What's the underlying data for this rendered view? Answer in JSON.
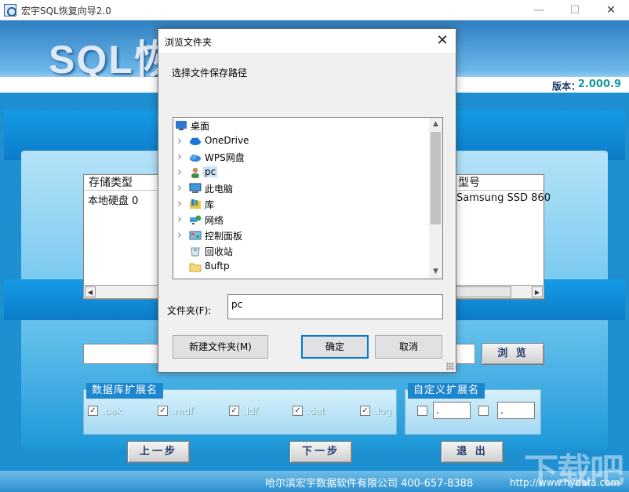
{
  "app": {
    "title": "宏宇SQL恢复向导2.0",
    "logo_text": "SQL恢",
    "version_label": "版本：",
    "version_value": "2.000.9"
  },
  "storage_table": {
    "columns": [
      "存储类型",
      "型号"
    ],
    "rows": [
      {
        "type": "本地硬盘 0",
        "model": "Samsung SSD 860"
      }
    ]
  },
  "path": {
    "value": "",
    "browse_label": "浏 览"
  },
  "db_ext_group": {
    "title": "数据库扩展名",
    "items": [
      {
        "label": ".bak",
        "checked": true
      },
      {
        "label": ".mdf",
        "checked": true
      },
      {
        "label": ".ldf",
        "checked": true
      },
      {
        "label": ".dat",
        "checked": true
      },
      {
        "label": ".log",
        "checked": true
      }
    ]
  },
  "custom_ext_group": {
    "title": "自定义扩展名",
    "items": [
      {
        "value": ".",
        "checked": false
      },
      {
        "value": ".",
        "checked": false
      }
    ]
  },
  "nav": {
    "prev_label": "上一步",
    "next_label": "下一步",
    "exit_label": "退 出"
  },
  "footer": {
    "company": "哈尔滨宏宇数据软件有限公司 400-657-8388",
    "url": "http://www.hydata.com",
    "watermark": "下载吧"
  },
  "dialog": {
    "title": "浏览文件夹",
    "description": "选择文件保存路径",
    "tree": [
      {
        "label": "桌面",
        "icon": "desktop-icon",
        "expandable": false,
        "selected": false,
        "indent": 0
      },
      {
        "label": "OneDrive",
        "icon": "cloud-icon",
        "expandable": true,
        "selected": false,
        "indent": 1
      },
      {
        "label": "WPS网盘",
        "icon": "cloud-drive-icon",
        "expandable": true,
        "selected": false,
        "indent": 1
      },
      {
        "label": "pc",
        "icon": "user-icon",
        "expandable": true,
        "selected": true,
        "indent": 1
      },
      {
        "label": "此电脑",
        "icon": "computer-icon",
        "expandable": true,
        "selected": false,
        "indent": 1
      },
      {
        "label": "库",
        "icon": "library-icon",
        "expandable": true,
        "selected": false,
        "indent": 1
      },
      {
        "label": "网络",
        "icon": "network-icon",
        "expandable": true,
        "selected": false,
        "indent": 1
      },
      {
        "label": "控制面板",
        "icon": "control-panel-icon",
        "expandable": true,
        "selected": false,
        "indent": 1
      },
      {
        "label": "回收站",
        "icon": "recycle-bin-icon",
        "expandable": false,
        "selected": false,
        "indent": 1
      },
      {
        "label": "8uftp",
        "icon": "folder-icon",
        "expandable": false,
        "selected": false,
        "indent": 1
      }
    ],
    "folder_label": "文件夹(F):",
    "folder_value": "pc",
    "new_folder_label": "新建文件夹(M)",
    "ok_label": "确定",
    "cancel_label": "取消"
  },
  "colors": {
    "client_bg": "#1e8fd0",
    "accent_blue": "#0078d7",
    "selection": "#cce4f7",
    "version_value": "#1a9a9a"
  }
}
